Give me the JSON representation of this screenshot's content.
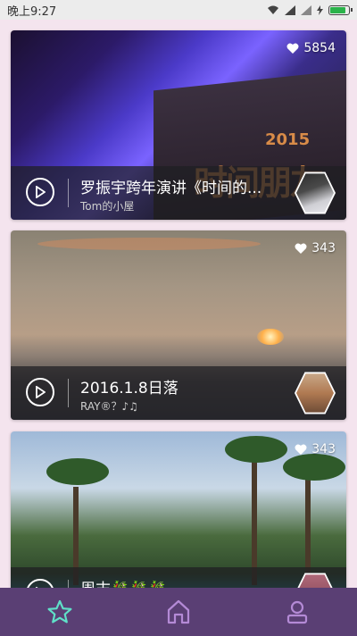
{
  "status_bar": {
    "time": "晚上9:27"
  },
  "cards": [
    {
      "likes": "5854",
      "title": "罗振宇跨年演讲《时间的...",
      "author": "Tom的小屋",
      "poster_text": "时间朋友",
      "poster_year": "2015"
    },
    {
      "likes": "343",
      "title": "2016.1.8日落",
      "author": "RAY®？♪♫"
    },
    {
      "likes": "343",
      "title": "周末🎋🎋🎋",
      "author": ""
    }
  ],
  "tabs": [
    {
      "icon": "star-icon",
      "active": true
    },
    {
      "icon": "home-icon",
      "active": false
    },
    {
      "icon": "profile-icon",
      "active": false
    }
  ],
  "colors": {
    "tab_bar": "#5a3f74",
    "active_tab": "#5fe0c8",
    "inactive_tab": "#b48ad6",
    "background": "#f4e4ee"
  }
}
